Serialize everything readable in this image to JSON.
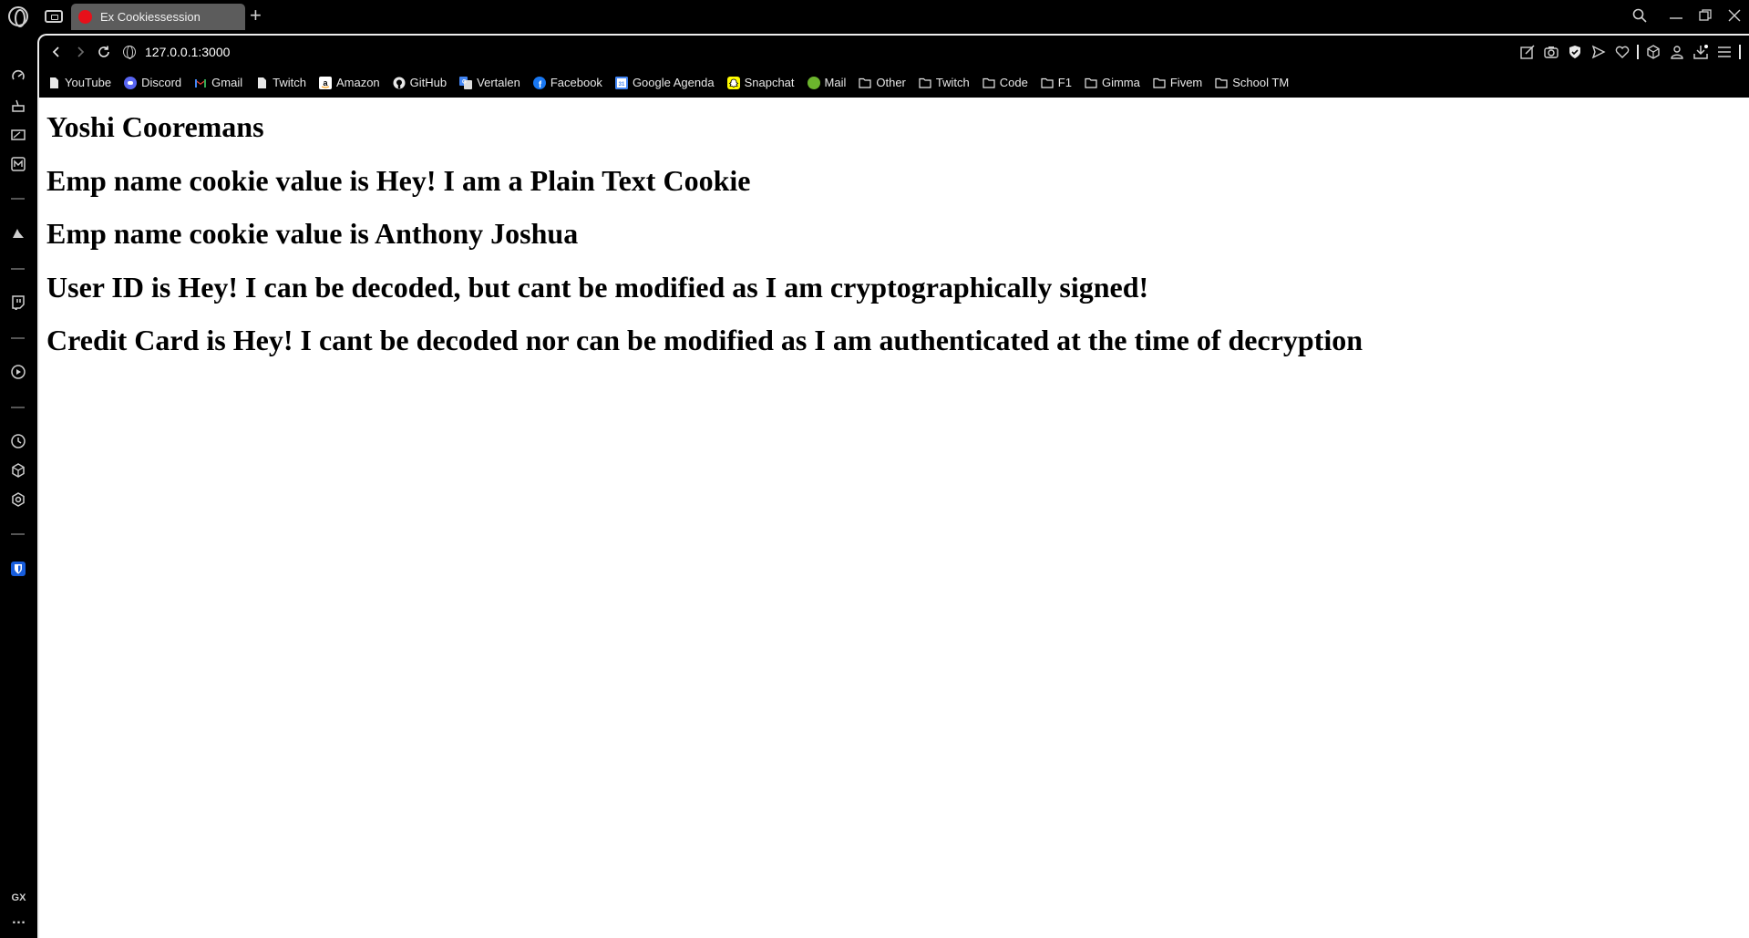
{
  "browser": {
    "tab": {
      "title": "Ex Cookiessession",
      "favicon_color": "#e8101a"
    },
    "url": "127.0.0.1:3000",
    "window_controls": [
      "search-icon",
      "minimize-icon",
      "restore-icon",
      "close-icon"
    ]
  },
  "bookmarks": [
    {
      "label": "YouTube",
      "icon": "file-icon"
    },
    {
      "label": "Discord",
      "icon": "discord-icon"
    },
    {
      "label": "Gmail",
      "icon": "gmail-icon"
    },
    {
      "label": "Twitch",
      "icon": "file-icon"
    },
    {
      "label": "Amazon",
      "icon": "amazon-icon"
    },
    {
      "label": "GitHub",
      "icon": "github-icon"
    },
    {
      "label": "Vertalen",
      "icon": "translate-icon"
    },
    {
      "label": "Facebook",
      "icon": "facebook-icon"
    },
    {
      "label": "Google Agenda",
      "icon": "calendar-icon"
    },
    {
      "label": "Snapchat",
      "icon": "snapchat-icon"
    },
    {
      "label": "Mail",
      "icon": "mail-icon"
    },
    {
      "label": "Other",
      "icon": "folder-icon"
    },
    {
      "label": "Twitch",
      "icon": "folder-icon"
    },
    {
      "label": "Code",
      "icon": "folder-icon"
    },
    {
      "label": "F1",
      "icon": "folder-icon"
    },
    {
      "label": "Gimma",
      "icon": "folder-icon"
    },
    {
      "label": "Fivem",
      "icon": "folder-icon"
    },
    {
      "label": "School TM",
      "icon": "folder-icon"
    }
  ],
  "sidebar": {
    "bottom_label": "GX",
    "more_label": "…"
  },
  "page": {
    "headings": [
      "Yoshi Cooremans",
      "Emp name cookie value is Hey! I am a Plain Text Cookie",
      "Emp name cookie value is Anthony Joshua",
      "User ID is Hey! I can be decoded, but cant be modified as I am cryptographically signed!",
      "Credit Card is Hey! I cant be decoded nor can be modified as I am authenticated at the time of decryption"
    ]
  }
}
